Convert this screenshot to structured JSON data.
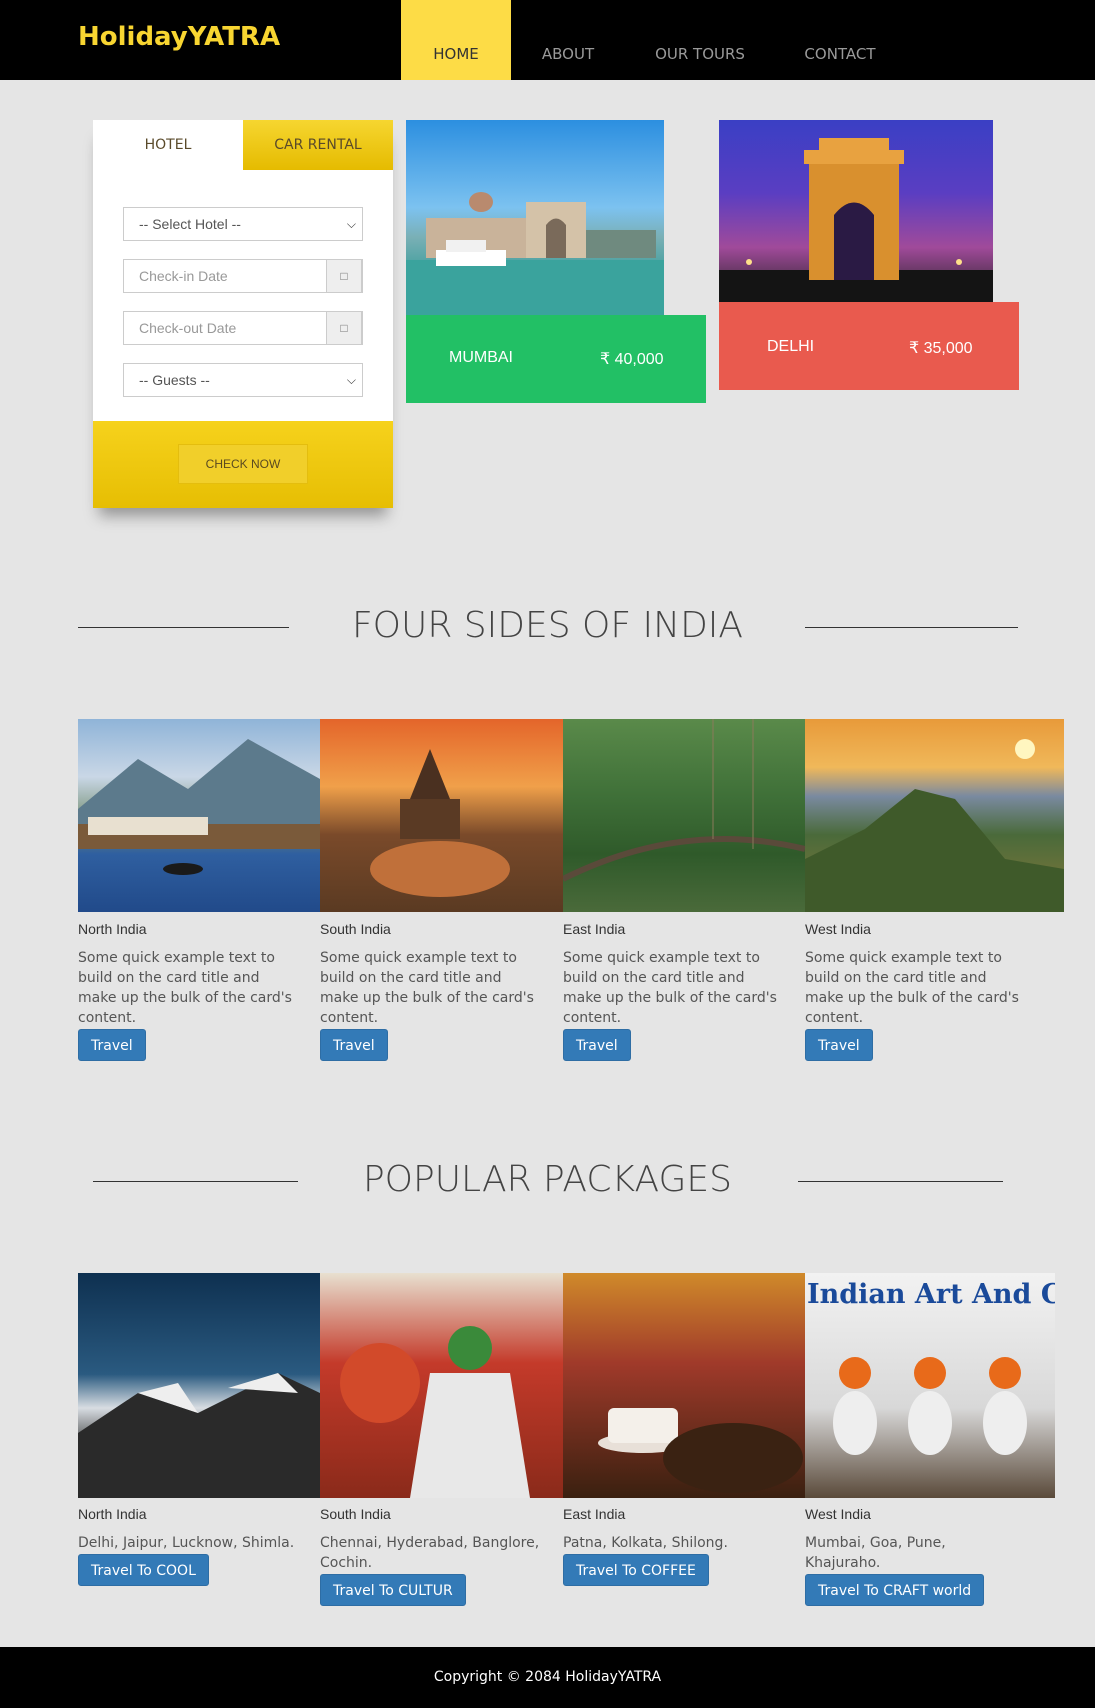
{
  "brand": "HolidayYATRA",
  "nav": {
    "home": "HOME",
    "about": "ABOUT",
    "tours": "OUR TOURS",
    "contact": "CONTACT"
  },
  "booking": {
    "tab_hotel": "HOTEL",
    "tab_car": "CAR RENTAL",
    "select_hotel": "-- Select Hotel --",
    "checkin_placeholder": "Check-in Date",
    "checkout_placeholder": "Check-out Date",
    "guests": "-- Guests --",
    "check_now": "CHECK NOW"
  },
  "cities": [
    {
      "name": "MUMBAI",
      "price": "₹ 40,000"
    },
    {
      "name": "DELHI",
      "price": "₹ 35,000"
    }
  ],
  "four_sides": {
    "title": "FOUR SIDES OF INDIA",
    "cards": [
      {
        "title": "North India",
        "text": "Some quick example text to build on the card title and make up the bulk of the card's content.",
        "button": "Travel"
      },
      {
        "title": "South India",
        "text": "Some quick example text to build on the card title and make up the bulk of the card's content.",
        "button": "Travel"
      },
      {
        "title": "East India",
        "text": "Some quick example text to build on the card title and make up the bulk of the card's content.",
        "button": "Travel"
      },
      {
        "title": "West India",
        "text": "Some quick example text to build on the card title and make up the bulk of the card's content.",
        "button": "Travel"
      }
    ]
  },
  "packages": {
    "title": "POPULAR PACKAGES",
    "image_caption_4": "Indian Art And Craft",
    "cards": [
      {
        "title": "North India",
        "text": "Delhi, Jaipur, Lucknow, Shimla.",
        "button": "Travel To COOL"
      },
      {
        "title": "South India",
        "text": "Chennai, Hyderabad, Banglore, Cochin.",
        "button": "Travel To CULTUR"
      },
      {
        "title": "East India",
        "text": "Patna, Kolkata, Shilong.",
        "button": "Travel To COFFEE"
      },
      {
        "title": "West India",
        "text": "Mumbai, Goa, Pune, Khajuraho.",
        "button": "Travel To CRAFT world"
      }
    ]
  },
  "footer": "Copyright © 2084 HolidayYATRA",
  "colors": {
    "brand_yellow": "#f8d531",
    "mumbai_green": "#22c065",
    "delhi_red": "#e95a4e",
    "button_blue": "#337ab7"
  }
}
